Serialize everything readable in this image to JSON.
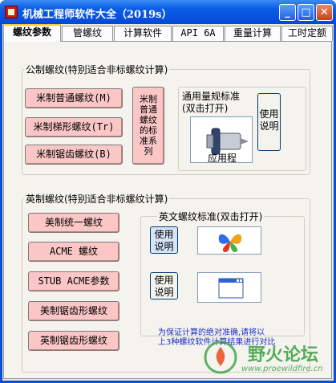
{
  "window": {
    "title": "机械工程师软件大全（2019s）",
    "min_glyph": "_",
    "max_glyph": "□",
    "close_glyph": "✕"
  },
  "tabs": [
    "螺纹参数",
    "管螺纹",
    "计算软件",
    "API 6A",
    "重量计算",
    "工时定额"
  ],
  "metric": {
    "legend": "公制螺纹(特别适合非标螺纹计算)",
    "buttons": [
      "米制普通螺纹(M)",
      "米制梯形螺纹(Tr)",
      "米制锯齿螺纹(B)"
    ],
    "standard_button": [
      "米制",
      "普通",
      "螺纹",
      "的标",
      "准系",
      "列"
    ],
    "gauge_frame": {
      "title_line1": "通用量规标准",
      "title_line2": "(双击打开)",
      "image_caption": "应用程"
    },
    "help_button": [
      "使用",
      "说明"
    ]
  },
  "imperial": {
    "legend": "英制螺纹(特别适合非标螺纹计算)",
    "buttons": [
      "美制统一螺纹",
      "ACME 螺纹",
      "STUB ACME参数",
      "美制锯齿形螺纹",
      "英制锯齿形螺纹"
    ],
    "standard_frame_title": "英文螺纹标准(双击打开)",
    "help_button_1": [
      "使用",
      "说明"
    ],
    "help_button_2": [
      "使用",
      "说明"
    ],
    "note_line1": "为保证计算的绝对准确,请将以",
    "note_line2": "上3种螺纹软件计算结果进行对比"
  },
  "watermark": {
    "text": "野火论坛",
    "url": "www.proewildfire.cn"
  },
  "colors": {
    "accent_pink": "#fbc6c6",
    "title_blue": "#0548d8",
    "note_blue": "#1e2cc8",
    "watermark_green": "#3aa040"
  }
}
